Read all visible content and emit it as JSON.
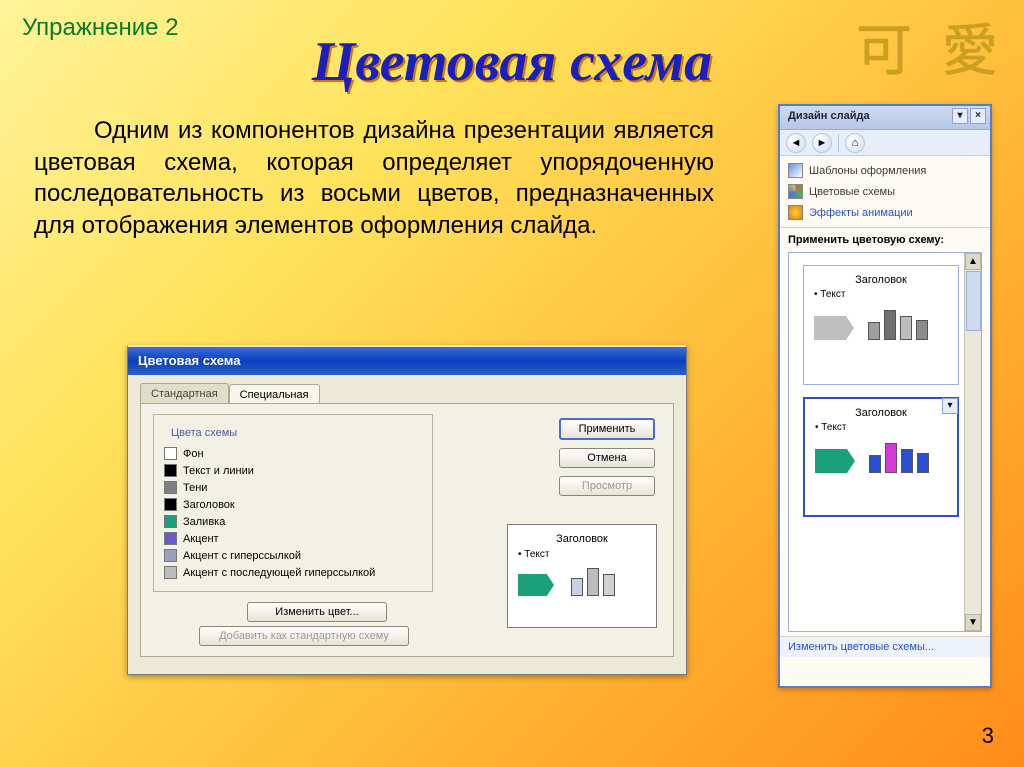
{
  "exercise_label": "Упражнение 2",
  "decor_cjk": "可 愛",
  "title": "Цветовая схема",
  "body_text": "Одним из компонентов дизайна презентации является цветовая схема, которая определяет упорядоченную последовательность из восьми цветов, предназначенных для отображения элементов оформления слайда.",
  "page_num": "3",
  "dialog": {
    "title": "Цветовая схема",
    "tabs": {
      "standard": "Стандартная",
      "custom": "Специальная"
    },
    "group_title": "Цвета схемы",
    "items": [
      {
        "label": "Фон",
        "color": "#ffffff"
      },
      {
        "label": "Текст и линии",
        "color": "#000000"
      },
      {
        "label": "Тени",
        "color": "#808080"
      },
      {
        "label": "Заголовок",
        "color": "#000000"
      },
      {
        "label": "Заливка",
        "color": "#1aa07a"
      },
      {
        "label": "Акцент",
        "color": "#6a5acd"
      },
      {
        "label": "Акцент с гиперссылкой",
        "color": "#9aa0c0"
      },
      {
        "label": "Акцент с последующей гиперссылкой",
        "color": "#bcbcbc"
      }
    ],
    "change_color": "Изменить цвет...",
    "add_std": "Добавить как стандартную схему",
    "apply": "Применить",
    "cancel": "Отмена",
    "preview": "Просмотр",
    "sample_title": "Заголовок",
    "sample_bullet": "Текст"
  },
  "taskpane": {
    "title": "Дизайн слайда",
    "links": {
      "templates": "Шаблоны оформления",
      "colors": "Цветовые схемы",
      "anim": "Эффекты анимации"
    },
    "apply_label": "Применить цветовую схему:",
    "cards": [
      {
        "title": "Заголовок",
        "bullet": "Текст",
        "shape": "#bfbfbf",
        "bars": [
          "#9e9e9e",
          "#707070",
          "#bdbdbd",
          "#8c8c8c"
        ]
      },
      {
        "title": "Заголовок",
        "bullet": "Текст",
        "shape": "#1aa07a",
        "bars": [
          "#2a4fcf",
          "#d63ad6",
          "#2a4fcf",
          "#2a4fcf"
        ]
      }
    ],
    "footer": "Изменить цветовые схемы..."
  }
}
